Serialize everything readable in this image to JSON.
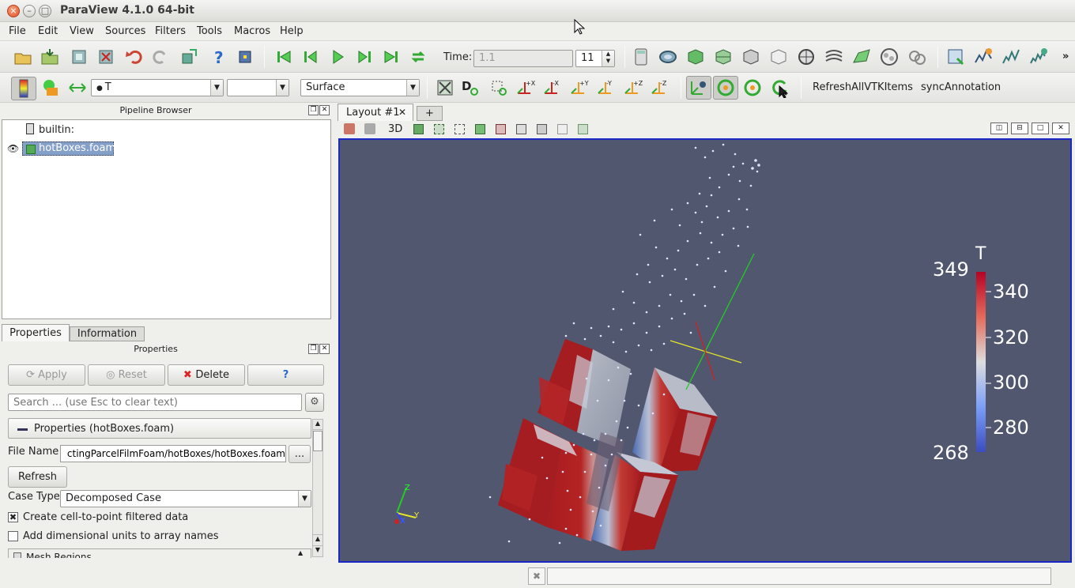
{
  "window": {
    "title": "ParaView 4.1.0 64-bit"
  },
  "menu": [
    "File",
    "Edit",
    "View",
    "Sources",
    "Filters",
    "Tools",
    "Macros",
    "Help"
  ],
  "toolbar": {
    "time_label": "Time:",
    "time_value": "1.1",
    "timestep": "11"
  },
  "toolbar2": {
    "array": "T",
    "representation": "Surface",
    "macro1": "RefreshAllVTKItems",
    "macro2": "syncAnnotation"
  },
  "pipeline": {
    "title": "Pipeline Browser",
    "items": [
      {
        "label": "builtin:"
      },
      {
        "label": "hotBoxes.foam"
      }
    ]
  },
  "tabs": {
    "properties": "Properties",
    "information": "Information"
  },
  "properties": {
    "title": "Properties",
    "apply": "Apply",
    "reset": "Reset",
    "delete": "Delete",
    "help": "?",
    "search_placeholder": "Search ... (use Esc to clear text)",
    "section": "Properties (hotBoxes.foam)",
    "file_name_label": "File Name",
    "file_name_value": "ctingParcelFilmFoam/hotBoxes/hotBoxes.foam",
    "browse": "...",
    "refresh": "Refresh",
    "case_type_label": "Case Type",
    "case_type_value": "Decomposed Case",
    "cb1": "Create cell-to-point filtered data",
    "cb2": "Add dimensional units to array names",
    "mesh_regions": "Mesh Regions"
  },
  "layout": {
    "tab": "Layout #1",
    "add": "+",
    "mode3d": "3D"
  },
  "colorbar": {
    "title": "T",
    "min": "268",
    "max": "349",
    "ticks": [
      "340",
      "320",
      "300",
      "280"
    ]
  },
  "axes": {
    "x": "X",
    "y": "Y",
    "z": "Z"
  }
}
